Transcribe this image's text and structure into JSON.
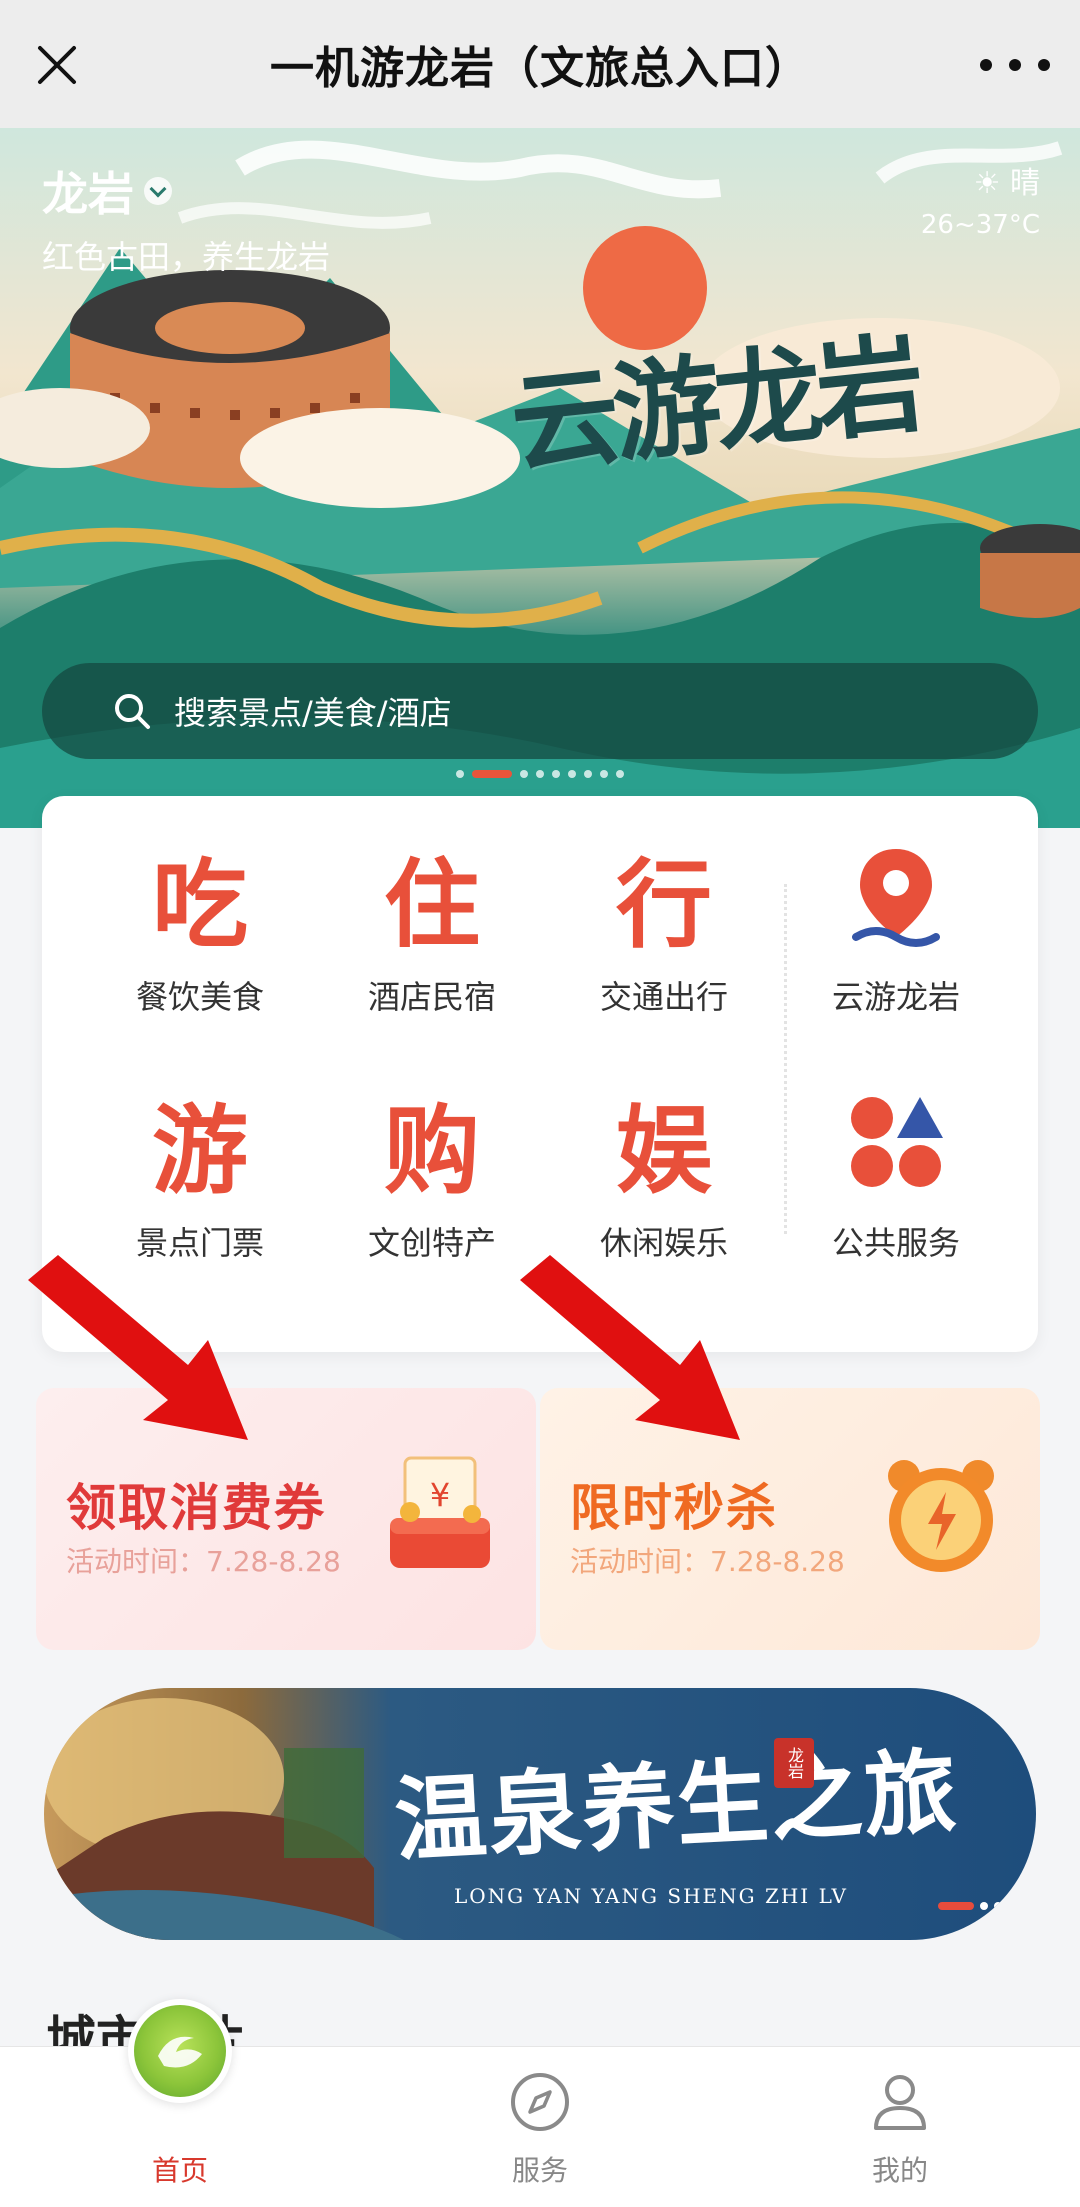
{
  "titlebar": {
    "title": "一机游龙岩（文旅总入口）",
    "close_icon": "close-icon",
    "more_icon": "more-icon"
  },
  "hero": {
    "city": "龙岩",
    "slogan": "红色古田，养生龙岩",
    "weather": "晴",
    "temperature": "26~37°C",
    "title": "云游龙岩",
    "search_placeholder": "搜索景点/美食/酒店",
    "carousel_active_index": 1,
    "carousel_count": 9
  },
  "grid": {
    "items": [
      {
        "glyph": "吃",
        "label": "餐饮美食",
        "icon": "dining-icon"
      },
      {
        "glyph": "住",
        "label": "酒店民宿",
        "icon": "hotel-icon"
      },
      {
        "glyph": "行",
        "label": "交通出行",
        "icon": "transport-icon"
      },
      {
        "glyph": "",
        "label": "云游龙岩",
        "icon": "location-pin-icon"
      },
      {
        "glyph": "游",
        "label": "景点门票",
        "icon": "tour-icon"
      },
      {
        "glyph": "购",
        "label": "文创特产",
        "icon": "shopping-icon"
      },
      {
        "glyph": "娱",
        "label": "休闲娱乐",
        "icon": "entertainment-icon"
      },
      {
        "glyph": "",
        "label": "公共服务",
        "icon": "public-service-icon"
      }
    ]
  },
  "promos": [
    {
      "title": "领取消费券",
      "subtitle": "活动时间：7.28-8.28",
      "icon": "coupon-icon"
    },
    {
      "title": "限时秒杀",
      "subtitle": "活动时间：7.28-8.28",
      "icon": "alarm-clock-icon"
    }
  ],
  "banner": {
    "title": "温泉养生之旅",
    "subtitle": "LONG YAN YANG SHENG ZHI LV",
    "seal": "龙岩"
  },
  "section": {
    "title": "城市名片"
  },
  "tabbar": {
    "items": [
      {
        "label": "首页",
        "icon": "home-icon",
        "active": true
      },
      {
        "label": "服务",
        "icon": "compass-icon",
        "active": false
      },
      {
        "label": "我的",
        "icon": "user-icon",
        "active": false
      }
    ]
  },
  "colors": {
    "accent": "#e8503a",
    "active_tab": "#d8392d",
    "search_bg": "#14463e"
  }
}
